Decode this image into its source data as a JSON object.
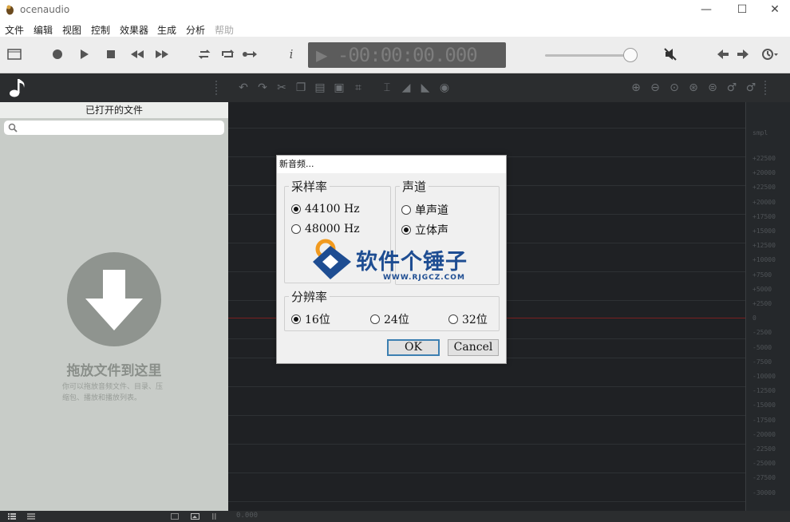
{
  "app": {
    "title": "ocenaudio"
  },
  "window_controls": {
    "minimize": "—",
    "maximize": "☐",
    "close": "✕"
  },
  "menu": [
    {
      "label": "文件",
      "enabled": true
    },
    {
      "label": "编辑",
      "enabled": true
    },
    {
      "label": "视图",
      "enabled": true
    },
    {
      "label": "控制",
      "enabled": true
    },
    {
      "label": "效果器",
      "enabled": true
    },
    {
      "label": "生成",
      "enabled": true
    },
    {
      "label": "分析",
      "enabled": true
    },
    {
      "label": "帮助",
      "enabled": false
    }
  ],
  "toolbar": {
    "time_display": "▶ -00:00:00.000",
    "info_label": "i"
  },
  "sidebar": {
    "files_header": "已打开的文件",
    "search_placeholder": "",
    "drop_title": "拖放文件到这里",
    "drop_desc": "你可以拖放音频文件、目录、压缩包、播放和播放列表。"
  },
  "ruler": {
    "unit": "smpl",
    "labels": [
      "+22500",
      "+20000",
      "+22500",
      "+20000",
      "+17500",
      "+15000",
      "+12500",
      "+10000",
      "+7500",
      "+5000",
      "+2500",
      "0",
      "-2500",
      "-5000",
      "-7500",
      "-10000",
      "-12500",
      "-15000",
      "-17500",
      "-20000",
      "-22500",
      "-25000",
      "-27500",
      "-30000"
    ]
  },
  "status": {
    "time": "0.000"
  },
  "dialog": {
    "title": "新音频...",
    "sample_rate": {
      "legend": "采样率",
      "options": [
        {
          "label": "44100 Hz",
          "selected": true
        },
        {
          "label": "48000 Hz",
          "selected": false
        }
      ]
    },
    "channels": {
      "legend": "声道",
      "options": [
        {
          "label": "单声道",
          "selected": false
        },
        {
          "label": "立体声",
          "selected": true
        }
      ]
    },
    "resolution": {
      "legend": "分辨率",
      "options": [
        {
          "label": "16位",
          "selected": true
        },
        {
          "label": "24位",
          "selected": false
        },
        {
          "label": "32位",
          "selected": false
        }
      ]
    },
    "ok_label": "OK",
    "cancel_label": "Cancel"
  },
  "watermark": {
    "text": "软件个锤子",
    "url": "WWW.RJGCZ.COM"
  },
  "colors": {
    "editor_bg": "#222528",
    "accent": "#3c7fb1",
    "watermark": "#1e4d92",
    "watermark_orange": "#f19a1f"
  }
}
